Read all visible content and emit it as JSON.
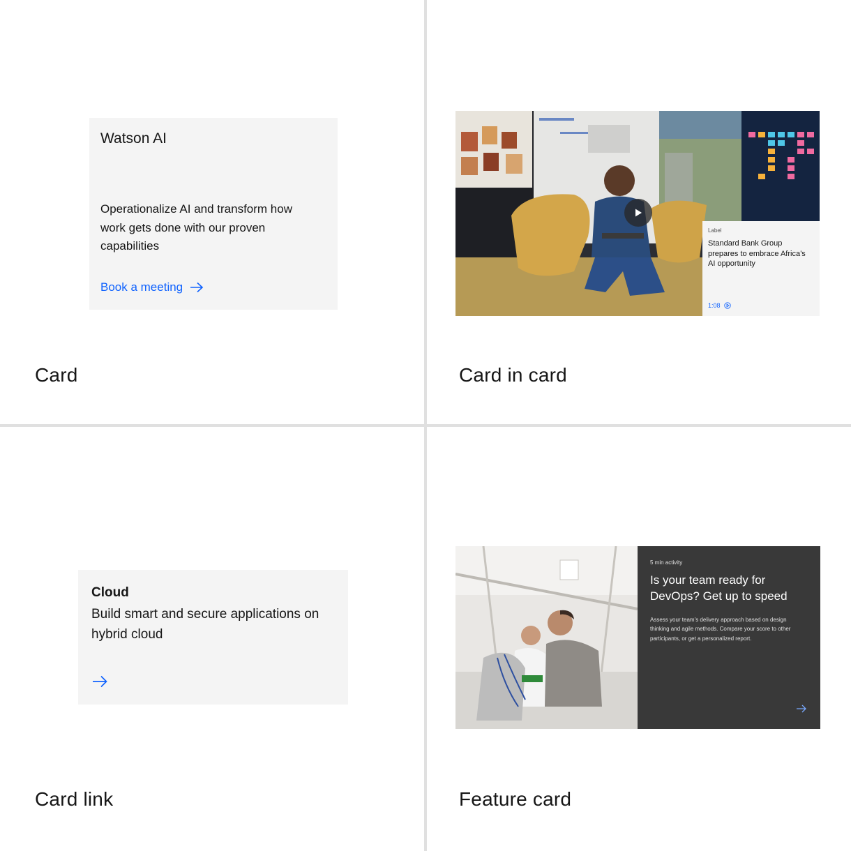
{
  "quadrants": {
    "card": {
      "caption": "Card",
      "title": "Watson AI",
      "description": "Operationalize AI and transform how work gets done with our proven capabilities",
      "link_label": "Book a meeting"
    },
    "card_in_card": {
      "caption": "Card in card",
      "inner": {
        "label": "Label",
        "title": "Standard Bank Group prepares to embrace Africa’s AI opportunity",
        "duration": "1:08"
      }
    },
    "card_link": {
      "caption": "Card link",
      "title": "Cloud",
      "description": "Build smart and secure applications on hybrid cloud"
    },
    "feature_card": {
      "caption": "Feature card",
      "eyebrow": "5 min activity",
      "title": "Is your team ready for DevOps? Get up to speed",
      "description": "Assess your team’s delivery approach based on design thinking and agile methods. Compare your score to other participants, or get a personalized report."
    }
  },
  "colors": {
    "link": "#0f62fe",
    "card_bg": "#f4f4f4",
    "feature_panel": "#393939",
    "divider": "#e0e0e0"
  }
}
